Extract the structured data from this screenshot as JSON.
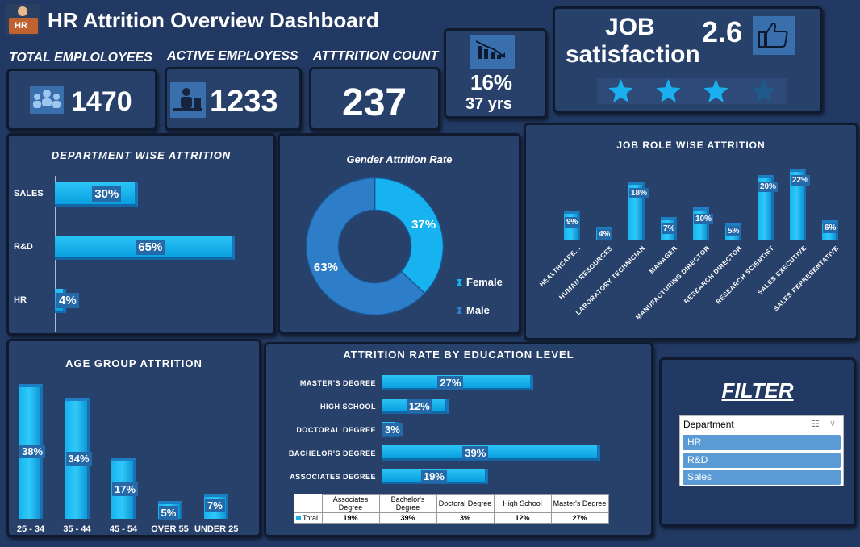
{
  "header": {
    "logo_text": "HR",
    "title": "HR Attrition Overview Dashboard"
  },
  "kpis": {
    "total_label": "TOTAL EMPLOLOYEES",
    "total_value": "1470",
    "active_label": "ACTIVE EMPLOYESS",
    "active_value": "1233",
    "attrition_label": "ATTTRITION COUNT",
    "attrition_value": "237",
    "attrition_rate": "16%",
    "avg_age": "37 yrs"
  },
  "job_satisfaction": {
    "label_line1": "JOB",
    "label_line2": "satisfaction",
    "value": "2.6",
    "stars_filled": 3,
    "stars_total": 4,
    "icon": "thumbs-up-icon"
  },
  "colors": {
    "background": "#223a63",
    "panel": "#28416b",
    "bar": "#17b3f0",
    "label_bg": "#2569a8",
    "star": "#1ab0f0",
    "star_dim": "#1e5a8a"
  },
  "chart_data": [
    {
      "type": "bar",
      "orientation": "horizontal",
      "title": "DEPARTMENT WISE ATTRITION",
      "categories": [
        "SALES",
        "R&D",
        "HR"
      ],
      "values": [
        30,
        65,
        4
      ],
      "labels": [
        "30%",
        "65%",
        "4%"
      ],
      "xlim": [
        0,
        70
      ]
    },
    {
      "type": "pie",
      "donut": true,
      "title": "Gender Attrition Rate",
      "categories": [
        "Female",
        "Male"
      ],
      "values": [
        37,
        63
      ],
      "labels": [
        "37%",
        "63%"
      ],
      "colors": [
        "#17b3f0",
        "#2e7dc8"
      ],
      "legend": "right"
    },
    {
      "type": "bar",
      "title": "JOB ROLE WISE ATTRITION",
      "categories": [
        "HEALTHCARE...",
        "HUMAN RESOURCES",
        "LABORATORY TECHNICIAN",
        "MANAGER",
        "MANUFACTURING DIRECTOR",
        "RESEARCH DIRECTOR",
        "RESEARCH SCIENTIST",
        "SALES EXECUTIVE",
        "SALES REPRESENTATIVE"
      ],
      "values": [
        9,
        4,
        18,
        7,
        10,
        5,
        20,
        22,
        6
      ],
      "labels": [
        "9%",
        "4%",
        "18%",
        "7%",
        "10%",
        "5%",
        "20%",
        "22%",
        "6%"
      ],
      "ylim": [
        0,
        24
      ]
    },
    {
      "type": "bar",
      "title": "AGE GROUP ATTRITION",
      "categories": [
        "25 - 34",
        "35 - 44",
        "45 - 54",
        "OVER 55",
        "UNDER 25"
      ],
      "values": [
        38,
        34,
        17,
        5,
        7
      ],
      "labels": [
        "38%",
        "34%",
        "17%",
        "5%",
        "7%"
      ],
      "ylim": [
        0,
        40
      ]
    },
    {
      "type": "bar",
      "orientation": "horizontal",
      "title": "ATTRITION RATE BY EDUCATION LEVEL",
      "categories": [
        "MASTER'S DEGREE",
        "HIGH SCHOOL",
        "DOCTORAL DEGREE",
        "BACHELOR'S DEGREE",
        "ASSOCIATES DEGREE"
      ],
      "values": [
        27,
        12,
        3,
        39,
        19
      ],
      "labels": [
        "27%",
        "12%",
        "3%",
        "39%",
        "19%"
      ],
      "xlim": [
        0,
        40
      ],
      "table": {
        "columns": [
          "Associates Degree",
          "Bachelor's Degree",
          "Doctoral Degree",
          "High School",
          "Master's Degree"
        ],
        "row_label": "Total",
        "row_values": [
          "19%",
          "39%",
          "3%",
          "12%",
          "27%"
        ]
      }
    }
  ],
  "filter": {
    "title": "FILTER",
    "slicer_header": "Department",
    "items": [
      "HR",
      "R&D",
      "Sales"
    ]
  }
}
